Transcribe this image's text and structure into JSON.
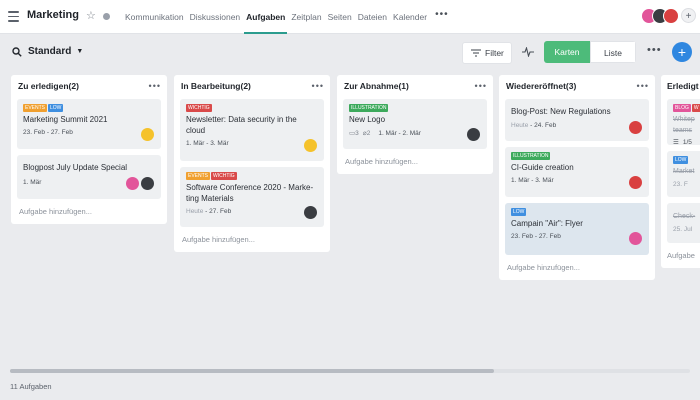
{
  "topbar": {
    "project_title": "Marketing",
    "tabs": [
      {
        "label": "Kommunikation"
      },
      {
        "label": "Diskussionen"
      },
      {
        "label": "Aufgaben",
        "active": true
      },
      {
        "label": "Zeitplan"
      },
      {
        "label": "Seiten"
      },
      {
        "label": "Dateien"
      },
      {
        "label": "Kalender"
      }
    ],
    "more": "•••",
    "add_member": "+"
  },
  "toolbar": {
    "view_name": "Standard",
    "filter_label": "Filter",
    "toggle_on": "Karten",
    "toggle_off": "Liste",
    "more": "•••",
    "add": "+"
  },
  "columns": [
    {
      "title": "Zu erledigen(2)",
      "cards": [
        {
          "tags": [
            {
              "text": "EVENTS",
              "color": "#f0a030"
            },
            {
              "text": "LOW",
              "color": "#3f8fe0"
            }
          ],
          "title": "Marketing Summit 2021",
          "date": "23. Feb - 27. Feb",
          "avatars": [
            "#f5c22b"
          ]
        },
        {
          "tags": [],
          "title": "Blogpost July Update Special",
          "date": "1. Mär",
          "avatars": [
            "#e2559a",
            "#3a3d42"
          ]
        }
      ],
      "add_label": "Aufgabe hinzufügen..."
    },
    {
      "title": "In Bearbeitung(2)",
      "cards": [
        {
          "tags": [
            {
              "text": "WICHTIG",
              "color": "#d94a4a"
            }
          ],
          "title": "Newsletter: Data security in the cloud",
          "date": "1. Mär - 3. Mär",
          "avatars": [
            "#f5c22b"
          ]
        },
        {
          "tags": [
            {
              "text": "EVENTS",
              "color": "#f0a030"
            },
            {
              "text": "WICHTIG",
              "color": "#d94a4a"
            }
          ],
          "title": "Software Conference 2020 - Marke-ting Materials",
          "date_muted": "Heute",
          "date": "- 27. Feb",
          "avatars": [
            "#3a3d42"
          ]
        }
      ],
      "add_label": "Aufgabe hinzufügen..."
    },
    {
      "title": "Zur Abnahme(1)",
      "cards": [
        {
          "tags": [
            {
              "text": "ILLUSTRATION",
              "color": "#3daa5c"
            }
          ],
          "title": "New Logo",
          "comments": "3",
          "attachments": "2",
          "date": "1. Mär - 2. Mär",
          "avatars": [
            "#3a3d42"
          ]
        }
      ],
      "add_label": "Aufgabe hinzufügen..."
    },
    {
      "title": "Wiedereröffnet(3)",
      "cards": [
        {
          "tags": [],
          "title": "Blog-Post: New Regulations",
          "date_muted": "Heute",
          "date": "- 24. Feb",
          "avatars": [
            "#d94040"
          ]
        },
        {
          "tags": [
            {
              "text": "ILLUSTRATION",
              "color": "#3daa5c"
            }
          ],
          "title": "CI-Guide creation",
          "date": "1. Mär - 3. Mär",
          "avatars": [
            "#d94040"
          ]
        },
        {
          "tags": [
            {
              "text": "LOW",
              "color": "#3f8fe0"
            }
          ],
          "title": "Campain \"Air\": Flyer",
          "date": "23. Feb - 27. Feb",
          "avatars": [
            "#e2559a"
          ],
          "highlight": true
        }
      ],
      "add_label": "Aufgabe hinzufügen..."
    },
    {
      "title": "Erledigt",
      "cards": [
        {
          "tags": [
            {
              "text": "BLOG",
              "color": "#e2559a"
            },
            {
              "text": "W",
              "color": "#d94a4a"
            }
          ],
          "title": "Whitep teams",
          "strike": true,
          "checklist": "1/5"
        },
        {
          "tags": [
            {
              "text": "LOW",
              "color": "#3f8fe0"
            }
          ],
          "title": "Market",
          "strike": true,
          "date": "23. F"
        },
        {
          "tags": [],
          "title": "Check-",
          "strike": true,
          "date": "25. Jul"
        }
      ],
      "add_label": "Aufgabe"
    }
  ],
  "footer": {
    "count": "11 Aufgaben"
  },
  "colors": {
    "accent_green": "#4dbb7a",
    "accent_blue": "#2f87e0",
    "active_tab_underline": "#2b9c8e"
  },
  "icons": {
    "menu": "hamburger-icon",
    "star": "star-icon",
    "search": "search-icon",
    "filter": "filter-icon",
    "activity": "activity-icon",
    "comment": "comment-icon",
    "attachment": "paperclip-icon",
    "checklist": "checklist-icon"
  }
}
